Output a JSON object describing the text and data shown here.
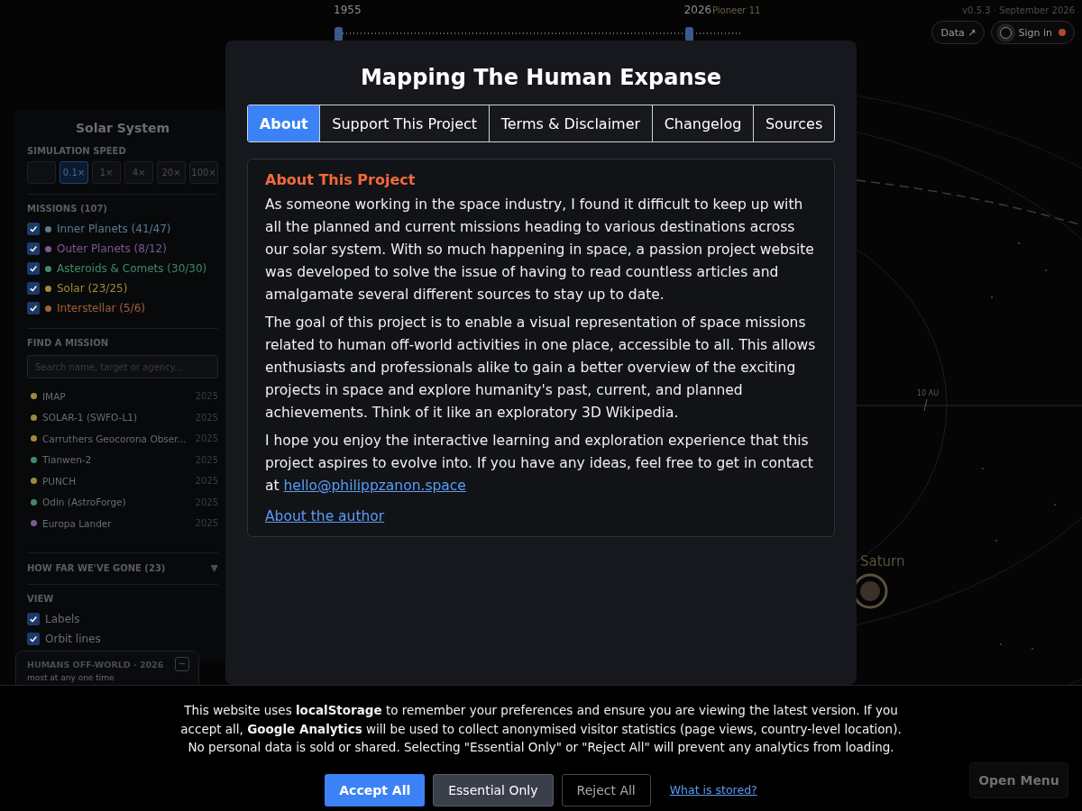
{
  "timeline": {
    "handles": [
      {
        "label": "1955",
        "level": 0
      },
      {
        "label": "2026",
        "level": 0.86
      }
    ],
    "marker": "Pioneer 11"
  },
  "version": "v0.5.3 · September 2026",
  "header_buttons": [
    {
      "kind": "link",
      "label": "Data ↗"
    },
    {
      "kind": "account",
      "label": "Sign in"
    }
  ],
  "sidebar": {
    "title": "Solar System",
    "speed": {
      "heading": "SIMULATION SPEED",
      "options": [
        {
          "kind": "blank",
          "selected": false
        },
        {
          "kind": "text",
          "label": "0.1×",
          "selected": true
        },
        {
          "kind": "text",
          "label": "1×",
          "selected": false
        },
        {
          "kind": "text",
          "label": "4×",
          "selected": false
        },
        {
          "kind": "text",
          "label": "20×",
          "selected": false
        },
        {
          "kind": "text",
          "label": "100×",
          "selected": false
        }
      ]
    },
    "missions": {
      "heading": "MISSIONS (107)",
      "categories": [
        {
          "label": "Inner Planets (41/47)",
          "checked": true,
          "color": "#5b7a8c"
        },
        {
          "label": "Outer Planets (8/12)",
          "checked": true,
          "color": "#7a5a8c"
        },
        {
          "label": "Asteroids & Comets (30/30)",
          "checked": true,
          "color": "#3f8a66"
        },
        {
          "label": "Solar (23/25)",
          "checked": true,
          "color": "#a08a3a"
        },
        {
          "label": "Interstellar (5/6)",
          "checked": true,
          "color": "#a0603a"
        }
      ]
    },
    "find": {
      "heading": "FIND A MISSION",
      "placeholder": "Search name, target or agency...",
      "results": [
        {
          "name": "IMAP",
          "year": "2025",
          "color": "#a08a3a"
        },
        {
          "name": "SOLAR-1 (SWFO-L1)",
          "year": "2025",
          "color": "#a08a3a"
        },
        {
          "name": "Carruthers Geocorona Obser...",
          "year": "2025",
          "color": "#a08a3a"
        },
        {
          "name": "Tianwen-2",
          "year": "2025",
          "color": "#3f8a66"
        },
        {
          "name": "PUNCH",
          "year": "2025",
          "color": "#a08a3a"
        },
        {
          "name": "Odin (AstroForge)",
          "year": "2025",
          "color": "#3f8a66"
        },
        {
          "name": "Europa Lander",
          "year": "2025",
          "color": "#7a5a8c"
        }
      ]
    },
    "how_far": {
      "label": "HOW FAR WE'VE GONE (23)",
      "toggle": "▼",
      "expanded": false
    },
    "view": {
      "heading": "VIEW",
      "items": [
        {
          "label": "Labels",
          "checked": true
        },
        {
          "label": "Orbit lines",
          "checked": true
        }
      ]
    }
  },
  "humans": {
    "title": "HUMANS OFF-WORLD · 2026",
    "toggle": "−",
    "subtitle": "most at any one time"
  },
  "map_labels": {
    "scale": "10 AU",
    "planet": "Saturn"
  },
  "open_menu": "Open Menu",
  "modal": {
    "title": "Mapping The Human Expanse",
    "tabs": [
      {
        "label": "About",
        "selected": true
      },
      {
        "label": "Support This Project",
        "selected": false
      },
      {
        "label": "Terms & Disclaimer",
        "selected": false
      },
      {
        "label": "Changelog",
        "selected": false
      },
      {
        "label": "Sources",
        "selected": false
      }
    ],
    "heading": "About This Project",
    "paragraphs": [
      {
        "text": "As someone working in the space industry, I found it difficult to keep up with all the planned and current missions heading to various destinations across our solar system. With so much happening in space, a passion project website was developed to solve the issue of having to read countless articles and amalgamate several different sources to stay up to date."
      },
      {
        "text": "The goal of this project is to enable a visual representation of space missions related to human off-world activities in one place, accessible to all. This allows enthusiasts and professionals alike to gain a better overview of the exciting projects in space and explore humanity's past, current, and planned achievements. Think of it like an exploratory 3D Wikipedia."
      },
      {
        "text": "I hope you enjoy the interactive learning and exploration experience that this project aspires to evolve into. If you have any ideas, feel free to get in contact at",
        "link": "hello@philippzanon.space"
      }
    ],
    "author_link": "About the author"
  },
  "cookie": {
    "text": "This website uses **localStorage** to remember your preferences and ensure you are viewing the latest version. If you accept all, **Google Analytics** will be used to collect anonymised visitor statistics (page views, country-level location). No personal data is sold or shared. Selecting \"Essential Only\" or \"Reject All\" will prevent any analytics from loading.",
    "buttons": [
      {
        "kind": "primary",
        "label": "Accept All"
      },
      {
        "kind": "secondary",
        "label": "Essential Only"
      },
      {
        "kind": "outline",
        "label": "Reject All"
      }
    ],
    "link": "What is stored?"
  }
}
